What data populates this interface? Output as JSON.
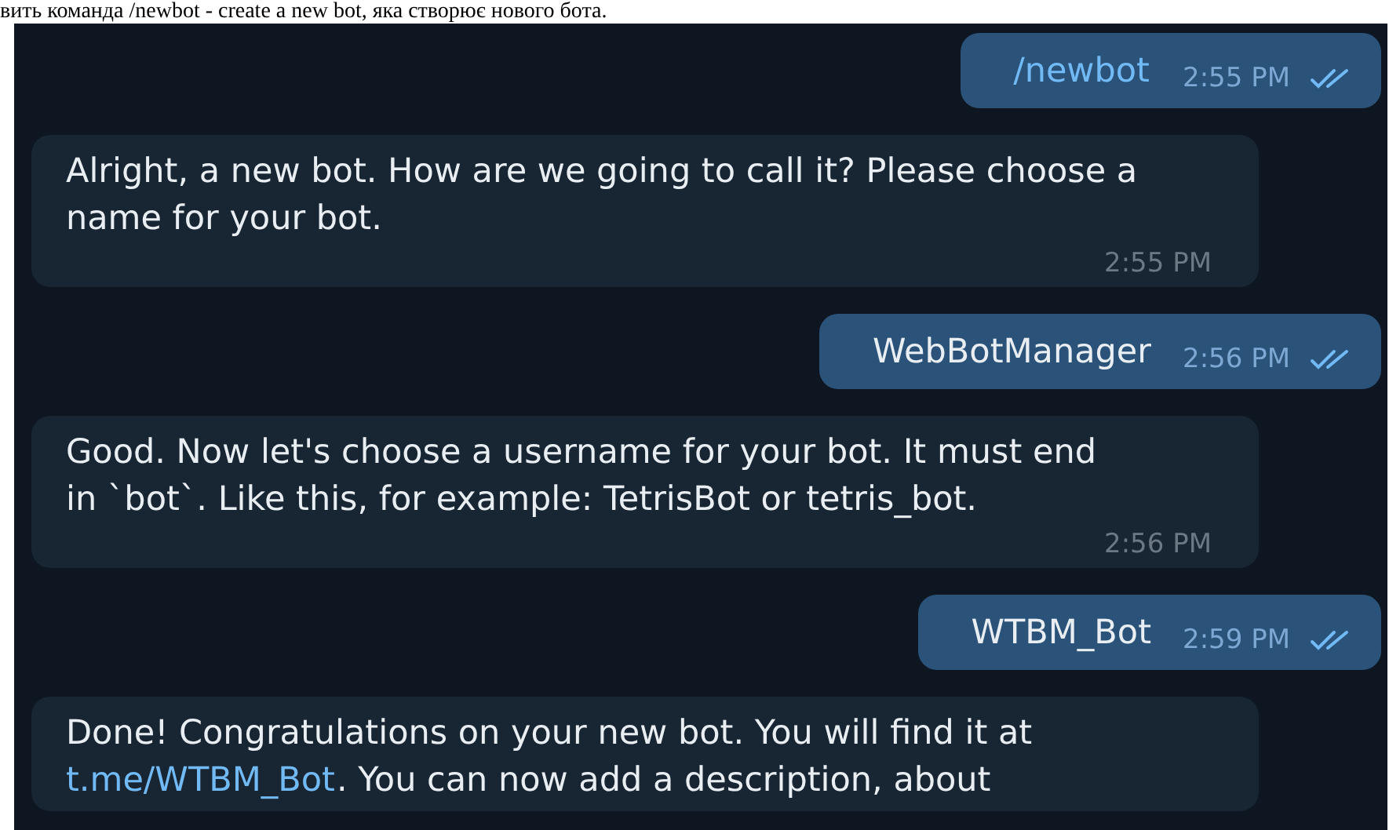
{
  "caption": "вить команда /newbot - create a new bot, яка створює нового бота.",
  "messages": [
    {
      "kind": "outgoing",
      "lines": [
        [
          {
            "text": "/newbot",
            "link": true
          }
        ]
      ],
      "time": "2:55 PM",
      "read": true
    },
    {
      "kind": "incoming",
      "lines": [
        [
          {
            "text": "Alright, a new bot. How are we going to call it? Please choose a",
            "link": false
          }
        ],
        [
          {
            "text": "name for your bot.",
            "link": false
          }
        ]
      ],
      "time": "2:55 PM"
    },
    {
      "kind": "outgoing",
      "lines": [
        [
          {
            "text": "WebBotManager",
            "link": false
          }
        ]
      ],
      "time": "2:56 PM",
      "read": true
    },
    {
      "kind": "incoming",
      "lines": [
        [
          {
            "text": "Good. Now let's choose a username for your bot. It must end",
            "link": false
          }
        ],
        [
          {
            "text": "in `bot`. Like this, for example: TetrisBot or tetris_bot.",
            "link": false
          }
        ]
      ],
      "time": "2:56 PM"
    },
    {
      "kind": "outgoing",
      "lines": [
        [
          {
            "text": "WTBM_Bot",
            "link": false
          }
        ]
      ],
      "time": "2:59 PM",
      "read": true
    },
    {
      "kind": "incoming",
      "lines": [
        [
          {
            "text": "Done! Congratulations on your new bot. You will find it at",
            "link": false
          }
        ],
        [
          {
            "text": "t.me/WTBM_Bot",
            "link": true
          },
          {
            "text": ". You can now add a description, about",
            "link": false
          }
        ]
      ]
    }
  ]
}
